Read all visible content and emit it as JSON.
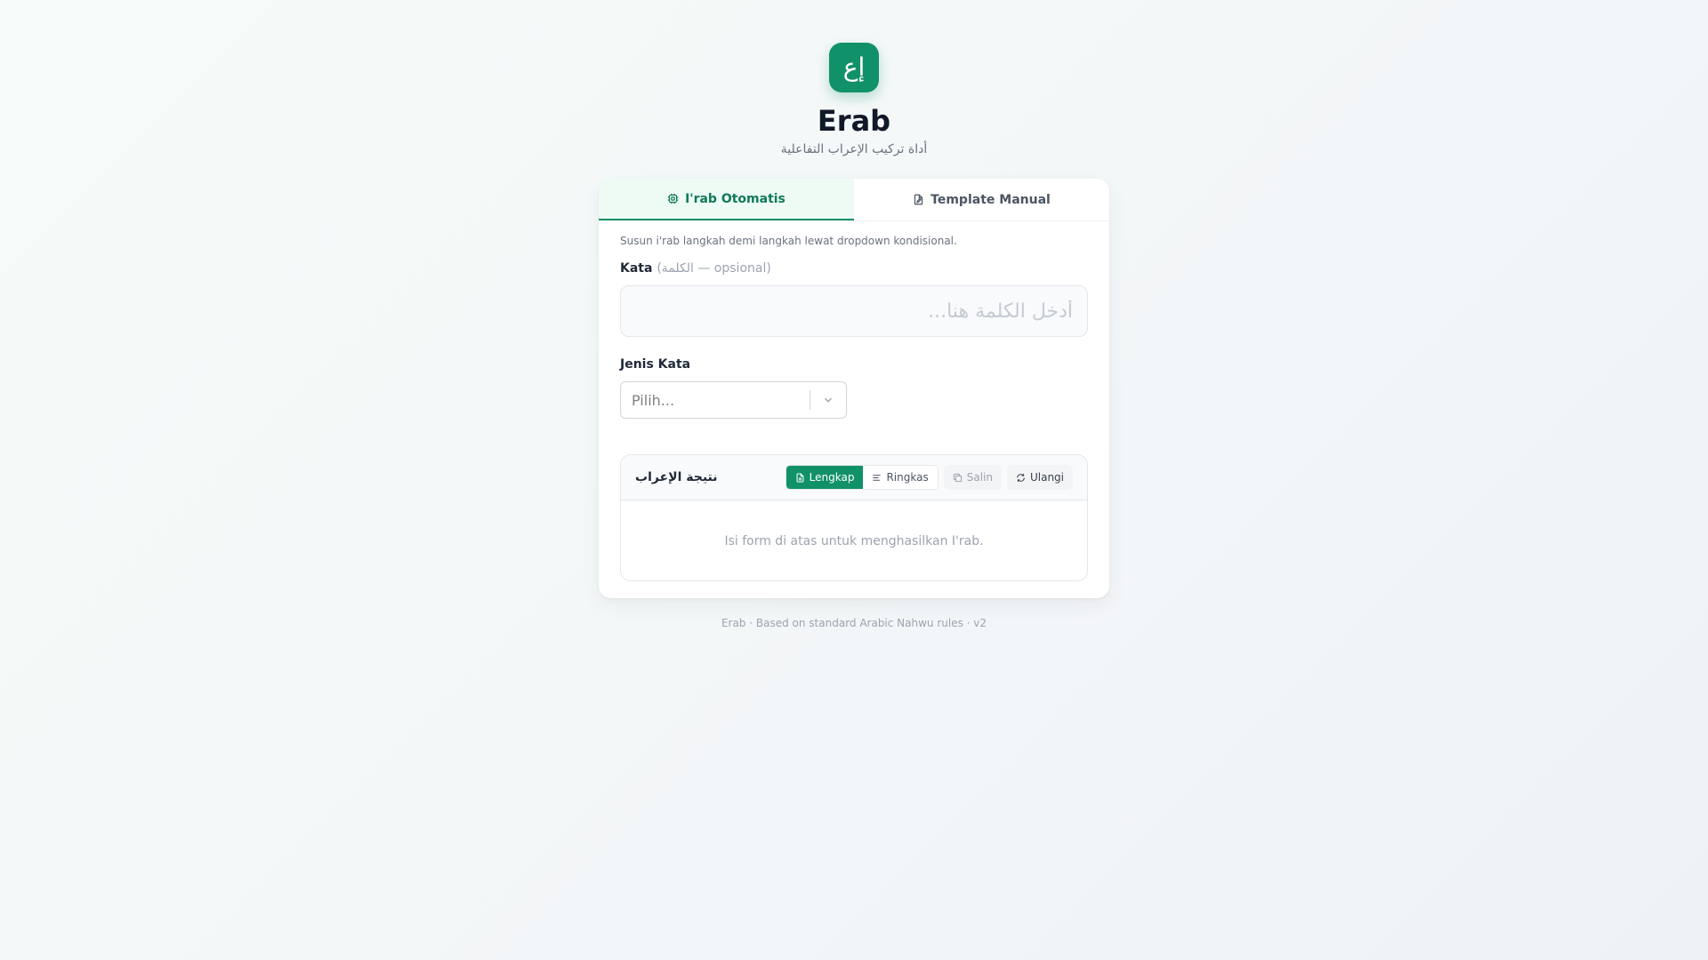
{
  "header": {
    "logo_glyph": "إع",
    "title": "Erab",
    "subtitle": "أداة تركيب الإعراب التفاعلية"
  },
  "tabs": [
    {
      "label": "I'rab Otomatis",
      "icon": "cpu-icon",
      "active": true
    },
    {
      "label": "Template Manual",
      "icon": "file-edit-icon",
      "active": false
    }
  ],
  "form": {
    "hint": "Susun i'rab langkah demi langkah lewat dropdown kondisional.",
    "kata_label": "Kata",
    "kata_sublabel": "(الكلمة — opsional)",
    "kata_value": "",
    "kata_placeholder": "أدخل الكلمة هنا...",
    "jenis_label": "Jenis Kata",
    "jenis_selected": "Pilih..."
  },
  "result": {
    "title": "نتيجة الإعراب",
    "view_modes": [
      {
        "label": "Lengkap",
        "icon": "file-text-icon",
        "active": true
      },
      {
        "label": "Ringkas",
        "icon": "list-icon",
        "active": false
      }
    ],
    "copy_label": "Salin",
    "reset_label": "Ulangi",
    "empty_message": "Isi form di atas untuk menghasilkan I'rab."
  },
  "footer": "Erab · Based on standard Arabic Nahwu rules · v2",
  "colors": {
    "primary": "#119169",
    "primary_tint": "#eefbf5",
    "text": "#1f2937",
    "muted": "#9ca3af"
  }
}
